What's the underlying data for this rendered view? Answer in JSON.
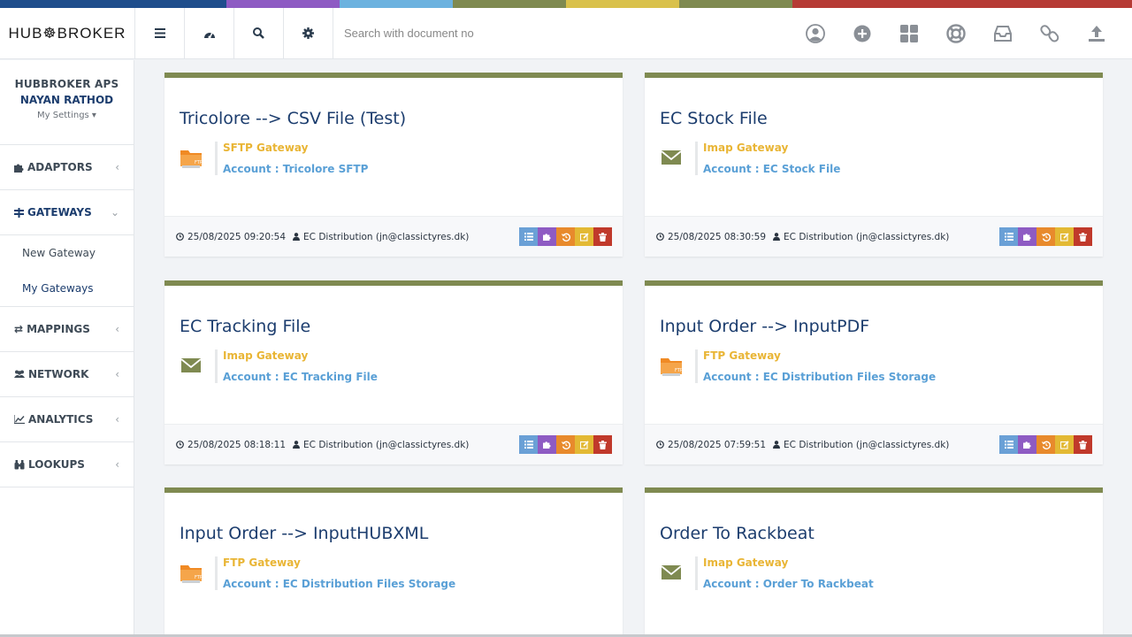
{
  "brand": {
    "logo": "HUB☸BROKER"
  },
  "stripe_colors": [
    "#1f4e8c",
    "#1f4e8c",
    "#8e5bc3",
    "#6cb2df",
    "#7f8a51",
    "#d9c14c",
    "#7f8a51",
    "#b63b35",
    "#b63b35",
    "#b63b35"
  ],
  "search": {
    "placeholder": "Search with document no"
  },
  "sidebar": {
    "org": "HUBBROKER APS",
    "user": "NAYAN RATHOD",
    "settings": "My Settings ▾",
    "menu": [
      {
        "label": "ADAPTORS",
        "icon": "puzzle-icon"
      },
      {
        "label": "GATEWAYS",
        "icon": "gateway-icon"
      },
      {
        "label": "MAPPINGS",
        "icon": "exchange-icon"
      },
      {
        "label": "NETWORK",
        "icon": "users-icon"
      },
      {
        "label": "ANALYTICS",
        "icon": "chart-icon"
      },
      {
        "label": "LOOKUPS",
        "icon": "binoculars-icon"
      }
    ],
    "gateways_sub": [
      {
        "label": "New Gateway"
      },
      {
        "label": "My Gateways"
      }
    ]
  },
  "cards": [
    {
      "title": "Tricolore --> CSV File (Test)",
      "type": "SFTP Gateway",
      "account": "Account : Tricolore SFTP",
      "icon": "ftp-folder-icon",
      "date": "25/08/2025 09:20:54",
      "user": "EC Distribution (jn@classictyres.dk)"
    },
    {
      "title": "EC Stock File",
      "type": "Imap Gateway",
      "account": "Account : EC Stock File",
      "icon": "envelope-icon",
      "date": "25/08/2025 08:30:59",
      "user": "EC Distribution (jn@classictyres.dk)"
    },
    {
      "title": "EC Tracking File",
      "type": "Imap Gateway",
      "account": "Account : EC Tracking File",
      "icon": "envelope-icon",
      "date": "25/08/2025 08:18:11",
      "user": "EC Distribution (jn@classictyres.dk)"
    },
    {
      "title": "Input Order --> InputPDF",
      "type": "FTP Gateway",
      "account": "Account : EC Distribution Files Storage",
      "icon": "ftp-folder-icon",
      "date": "25/08/2025 07:59:51",
      "user": "EC Distribution (jn@classictyres.dk)"
    },
    {
      "title": "Input Order --> InputHUBXML",
      "type": "FTP Gateway",
      "account": "Account : EC Distribution Files Storage",
      "icon": "ftp-folder-icon",
      "date": "",
      "user": ""
    },
    {
      "title": "Order To Rackbeat",
      "type": "Imap Gateway",
      "account": "Account : Order To Rackbeat",
      "icon": "envelope-icon",
      "date": "",
      "user": ""
    }
  ],
  "action_colors": {
    "list": "#6aa0d6",
    "adaptor": "#8e5bc3",
    "history": "#e88a2c",
    "edit": "#e3b934",
    "delete": "#c0392b"
  }
}
